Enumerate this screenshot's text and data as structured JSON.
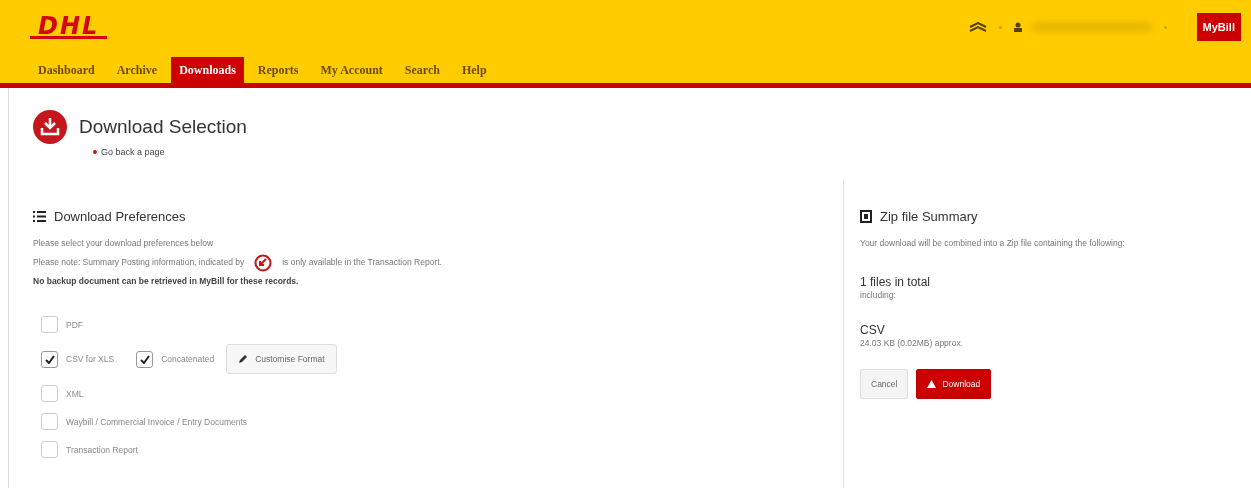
{
  "header": {
    "logo": "DHL",
    "app_button": "MyBill",
    "nav": [
      {
        "label": "Dashboard",
        "selected": false
      },
      {
        "label": "Archive",
        "selected": false
      },
      {
        "label": "Downloads",
        "selected": true
      },
      {
        "label": "Reports",
        "selected": false
      },
      {
        "label": "My Account",
        "selected": false
      },
      {
        "label": "Search",
        "selected": false
      },
      {
        "label": "Help",
        "selected": false
      }
    ]
  },
  "page": {
    "title": "Download Selection",
    "back_link": "Go back a page"
  },
  "preferences": {
    "title": "Download Preferences",
    "intro": "Please select your download preferences below",
    "note_before": "Please note: Summary Posting information, indicated by",
    "note_after": "is only available in the Transaction Report.",
    "warning": "No backup document can be retrieved in MyBill for these records.",
    "options": [
      {
        "label": "PDF",
        "checked": false
      },
      {
        "label": "CSV for XLS",
        "checked": true,
        "sub_option": {
          "label": "Concatenated",
          "checked": true
        },
        "button": "Customise Format"
      },
      {
        "label": "XML",
        "checked": false
      },
      {
        "label": "Waybill / Commercial Invoice / Entry Documents",
        "checked": false
      },
      {
        "label": "Transaction Report",
        "checked": false
      }
    ]
  },
  "summary": {
    "title": "Zip file Summary",
    "description": "Your download will be combined into a Zip file containing the following:",
    "total": "1 files in total",
    "including": "including:",
    "files": [
      {
        "type": "CSV",
        "size": "24.03 KB (0.02MB) approx."
      }
    ],
    "buttons": [
      {
        "label": "Cancel",
        "kind": "secondary"
      },
      {
        "label": "Download",
        "kind": "primary"
      }
    ]
  }
}
